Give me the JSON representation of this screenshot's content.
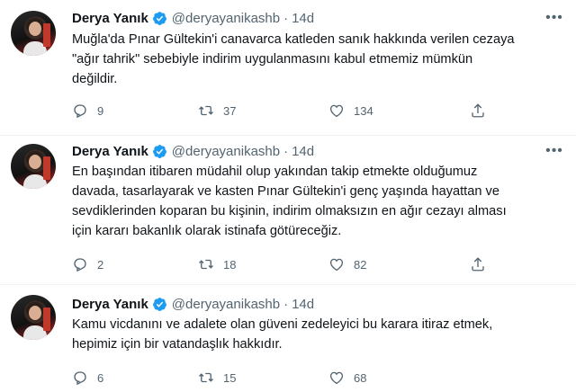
{
  "tweets": [
    {
      "name": "Derya Yanık",
      "handle": "@deryayanikashb",
      "separator": "·",
      "time": "14d",
      "text_lines": [
        "Muğla'da Pınar Gültekin'i canavarca katleden sanık hakkında verilen cezaya",
        "\"ağır tahrik\" sebebiyle indirim uygulanmasını kabul etmemiz mümkün",
        "değildir."
      ],
      "replies": "9",
      "retweets": "37",
      "likes": "134"
    },
    {
      "name": "Derya Yanık",
      "handle": "@deryayanikashb",
      "separator": "·",
      "time": "14d",
      "text_lines": [
        "En başından itibaren müdahil olup yakından takip etmekte olduğumuz",
        "davada, tasarlayarak ve kasten Pınar Gültekin'i genç yaşında hayattan ve",
        "sevdiklerinden koparan bu kişinin, indirim olmaksızın en ağır cezayı alması",
        "için kararı bakanlık olarak istinafa götüreceğiz."
      ],
      "replies": "2",
      "retweets": "18",
      "likes": "82"
    },
    {
      "name": "Derya Yanık",
      "handle": "@deryayanikashb",
      "separator": "·",
      "time": "14d",
      "text_lines": [
        "Kamu vicdanını ve adalete olan güveni zedeleyici bu karara itiraz etmek,",
        "hepimiz için bir vatandaşlık hakkıdır."
      ],
      "replies": "6",
      "retweets": "15",
      "likes": "68"
    }
  ],
  "icons": {
    "more": "more-horizontal-icon",
    "verified": "verified-badge-icon",
    "reply": "reply-icon",
    "retweet": "retweet-icon",
    "like": "heart-icon",
    "share": "share-icon"
  },
  "colors": {
    "verified": "#1d9bf0",
    "secondary_text": "#536471",
    "primary_text": "#0f1419",
    "separator": "#eff3f4"
  }
}
